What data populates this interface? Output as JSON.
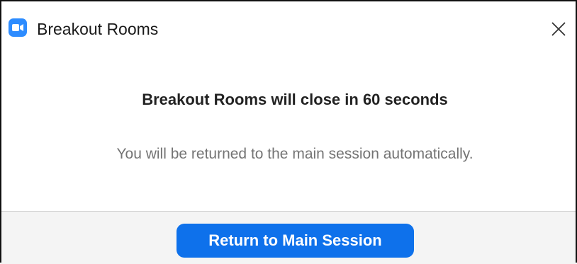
{
  "window": {
    "title": "Breakout Rooms",
    "app_icon": "zoom-video-icon",
    "close_icon": "close-icon"
  },
  "dialog": {
    "headline": "Breakout Rooms will close in 60 seconds",
    "message": "You will be returned to the main session automatically."
  },
  "footer": {
    "return_button_label": "Return to Main Session"
  },
  "colors": {
    "accent": "#0e71eb",
    "app_icon_bg": "#2d8cff",
    "footer_bg": "#f4f4f4",
    "message_text": "#747474"
  }
}
